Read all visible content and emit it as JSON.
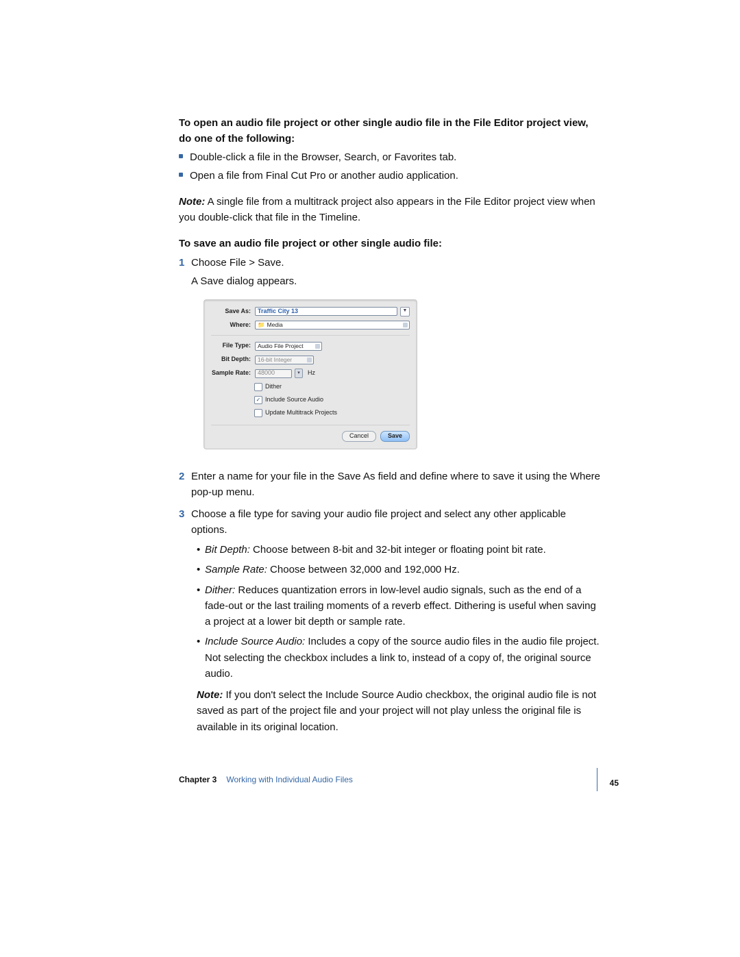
{
  "heading": "To open an audio file project or other single audio file in the File Editor project view, do one of the following:",
  "bullets": {
    "b0": "Double-click a file in the Browser, Search, or Favorites tab.",
    "b1": "Open a file from Final Cut Pro or another audio application."
  },
  "note1_label": "Note:",
  "note1_text": "  A single file from a multitrack project also appears in the File Editor project view when you double-click that file in the Timeline.",
  "subheading": "To save an audio file project or other single audio file:",
  "step1": "Choose File > Save.",
  "step1_sub": "A Save dialog appears.",
  "step2": "Enter a name for your file in the Save As field and define where to save it using the Where pop-up menu.",
  "step3": "Choose a file type for saving your audio file project and select any other applicable options.",
  "options": {
    "o0_label": "Bit Depth:",
    "o0_text": "  Choose between 8-bit and 32-bit integer or floating point bit rate.",
    "o1_label": "Sample Rate:",
    "o1_text": "  Choose between 32,000 and 192,000 Hz.",
    "o2_label": "Dither:",
    "o2_text": "  Reduces quantization errors in low-level audio signals, such as the end of a fade-out or the last trailing moments of a reverb effect. Dithering is useful when saving a project at a lower bit depth or sample rate.",
    "o3_label": "Include Source Audio:",
    "o3_text": "  Includes a copy of the source audio files in the audio file project. Not selecting the checkbox includes a link to, instead of a copy of, the original source audio."
  },
  "note2_label": "Note:",
  "note2_text": "  If you don't select the Include Source Audio checkbox, the original audio file is not saved as part of the project file and your project will not play unless the original file is available in its original location.",
  "dialog": {
    "save_as_label": "Save As:",
    "save_as_value": "Traffic City 13",
    "where_label": "Where:",
    "where_value": "Media",
    "filetype_label": "File Type:",
    "filetype_value": "Audio File Project",
    "bitdepth_label": "Bit Depth:",
    "bitdepth_value": "16-bit Integer",
    "samplerate_label": "Sample Rate:",
    "samplerate_value": "48000",
    "hz": "Hz",
    "dither": "Dither",
    "include_source": "Include Source Audio",
    "update_multi": "Update Multitrack Projects",
    "cancel": "Cancel",
    "save": "Save"
  },
  "footer": {
    "chapter": "Chapter 3",
    "title": "Working with Individual Audio Files",
    "page": "45"
  }
}
